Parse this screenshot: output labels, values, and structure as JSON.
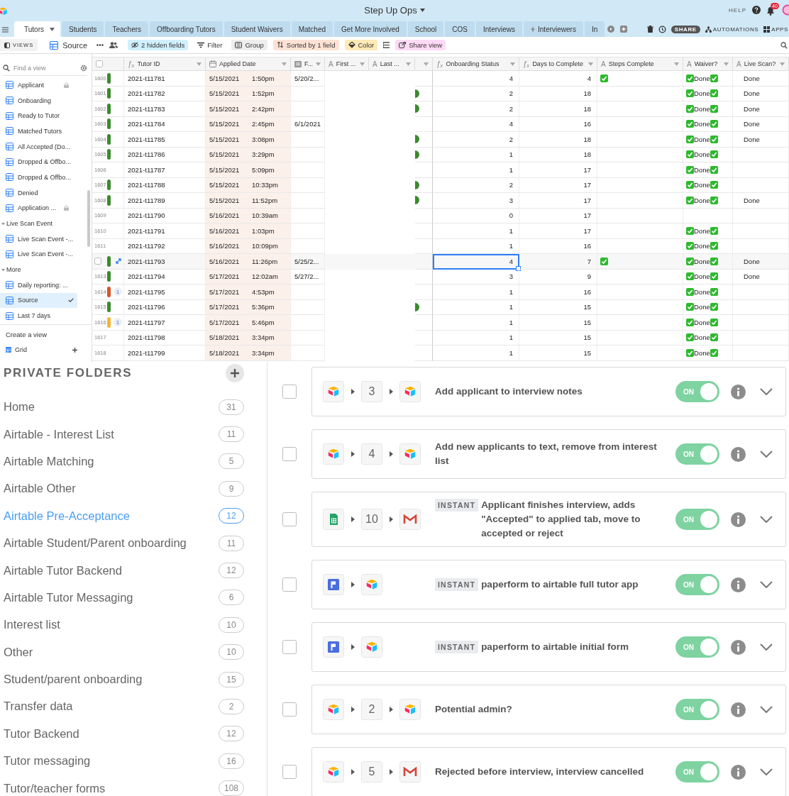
{
  "header": {
    "title": "Step Up Ops",
    "help": "HELP",
    "notifications": "40"
  },
  "tabs": [
    {
      "label": "Tutors",
      "kind": "plain",
      "selected": true
    },
    {
      "label": "Students",
      "kind": "plain",
      "selected": false
    },
    {
      "label": "Teachers",
      "kind": "plain",
      "selected": false
    },
    {
      "label": "Offboarding Tutors",
      "kind": "plain",
      "selected": false
    },
    {
      "label": "Student Waivers",
      "kind": "plain",
      "selected": false
    },
    {
      "label": "Matched",
      "kind": "plain",
      "selected": false
    },
    {
      "label": "Get More Involved",
      "kind": "plain",
      "selected": false
    },
    {
      "label": "School",
      "kind": "plain",
      "selected": false
    },
    {
      "label": "COS",
      "kind": "plain",
      "selected": false
    },
    {
      "label": "Interviews",
      "kind": "plain",
      "selected": false
    },
    {
      "label": "Interviewers",
      "kind": "synced",
      "selected": false
    },
    {
      "label": "In",
      "kind": "plain",
      "selected": false
    }
  ],
  "tab_actions": {
    "share": "SHARE",
    "automations": "AUTOMATIONS",
    "apps": "APPS"
  },
  "toolbar": {
    "views": "VIEWS",
    "view_name": "Source",
    "buttons": [
      {
        "label": "2 hidden fields",
        "kind": "hide",
        "color": "#d0f0fd"
      },
      {
        "label": "Filter",
        "kind": "filter"
      },
      {
        "label": "Group",
        "kind": "group",
        "color": "#eeeeee"
      },
      {
        "label": "Sorted by 1 field",
        "kind": "sort",
        "color": "#fee2d5"
      },
      {
        "label": "Color",
        "kind": "color",
        "color": "#ffeab6"
      }
    ],
    "share": {
      "label": "Share view",
      "color": "#ffdaf6"
    }
  },
  "sidebar": {
    "search": {
      "placeholder": "Find a view"
    },
    "views": [
      {
        "label": "Applicant",
        "kind": "view",
        "locked": true,
        "selected": false
      },
      {
        "label": "Onboarding",
        "kind": "view",
        "locked": false,
        "selected": false
      },
      {
        "label": "Ready to Tutor",
        "kind": "view",
        "locked": false,
        "selected": false
      },
      {
        "label": "Matched Tutors",
        "kind": "view",
        "locked": false,
        "selected": false
      },
      {
        "label": "All Accepted (Do...",
        "kind": "view",
        "locked": false,
        "selected": false
      },
      {
        "label": "Dropped & Offbo...",
        "kind": "view",
        "locked": false,
        "selected": false
      },
      {
        "label": "Dropped & Offbo...",
        "kind": "view",
        "locked": false,
        "selected": false
      },
      {
        "label": "Denied",
        "kind": "view",
        "locked": false,
        "selected": false
      },
      {
        "label": "Application ...",
        "kind": "view",
        "locked": true,
        "selected": false
      },
      {
        "label": "Live Scan Event",
        "kind": "section",
        "expanded": true,
        "children": [
          {
            "label": "Live Scan Event -...",
            "kind": "view",
            "locked": false,
            "selected": false
          },
          {
            "label": "Live Scan Event -...",
            "kind": "view",
            "locked": false,
            "selected": false
          }
        ]
      },
      {
        "label": "More",
        "kind": "section",
        "expanded": true,
        "children": [
          {
            "label": "Daily reporting: ...",
            "kind": "view",
            "locked": false,
            "selected": false
          },
          {
            "label": "Source",
            "kind": "view",
            "locked": false,
            "selected": true
          },
          {
            "label": "Last 7 days",
            "kind": "view",
            "locked": false,
            "selected": false
          }
        ]
      }
    ],
    "create": {
      "title": "Create a view",
      "options": [
        {
          "label": "Grid"
        }
      ]
    }
  },
  "grid": {
    "all_checked": false,
    "columns": [
      {
        "label": "Tutor ID",
        "kind": "formula",
        "icon": "ƒₓ"
      },
      {
        "label": "Applied Date",
        "kind": "date"
      },
      {
        "label": "F...",
        "kind": "calendar"
      },
      {
        "label": "First ...",
        "kind": "text",
        "icon": "A"
      },
      {
        "label": "Last ...",
        "kind": "text",
        "icon": "A"
      },
      {
        "kind": "none"
      },
      {
        "label": "Onboarding Status",
        "kind": "formula",
        "icon": "ƒₓ"
      },
      {
        "label": "Days to Complete",
        "kind": "formula",
        "icon": "ƒₓ"
      },
      {
        "label": "Steps Complete",
        "kind": "text",
        "icon": "A"
      },
      {
        "label": "Waiver?",
        "kind": "text",
        "icon": "A"
      },
      {
        "label": "Live Scan?",
        "kind": "text",
        "icon": "A"
      }
    ],
    "rows": [
      {
        "number": "1600",
        "color": "#3b8a2c",
        "tutor_id": "2021-t11781",
        "date": "5/15/2021",
        "time": "1:50pm",
        "f": "5/20/2...",
        "dot": false,
        "onboarding": "4",
        "days": "4",
        "steps_complete": true,
        "waiver": "Done",
        "live_scan": "Done",
        "hovered": false,
        "selected": false
      },
      {
        "number": "1601",
        "color": "#3b8a2c",
        "tutor_id": "2021-t11782",
        "date": "5/15/2021",
        "time": "1:52pm",
        "dot": true,
        "onboarding": "2",
        "days": "18",
        "steps_complete": false,
        "waiver": "Done",
        "live_scan": "Done",
        "hovered": false,
        "selected": false
      },
      {
        "number": "1602",
        "color": "#3b8a2c",
        "tutor_id": "2021-t11783",
        "date": "5/15/2021",
        "time": "2:42pm",
        "dot": true,
        "onboarding": "2",
        "days": "18",
        "steps_complete": false,
        "waiver": "Done",
        "live_scan": "Done",
        "hovered": false,
        "selected": false
      },
      {
        "number": "1603",
        "color": "#3b8a2c",
        "tutor_id": "2021-t11784",
        "date": "5/15/2021",
        "time": "2:45pm",
        "f": "6/1/2021",
        "dot": false,
        "onboarding": "4",
        "days": "16",
        "steps_complete": false,
        "waiver": "Done",
        "live_scan": "Done",
        "hovered": false,
        "selected": false
      },
      {
        "number": "1604",
        "color": "#3b8a2c",
        "tutor_id": "2021-t11785",
        "date": "5/15/2021",
        "time": "3:08pm",
        "dot": true,
        "onboarding": "2",
        "days": "18",
        "steps_complete": false,
        "waiver": "Done",
        "live_scan": "Done",
        "hovered": false,
        "selected": false
      },
      {
        "number": "1605",
        "color": "#3b8a2c",
        "tutor_id": "2021-t11786",
        "date": "5/15/2021",
        "time": "3:29pm",
        "dot": true,
        "onboarding": "1",
        "days": "18",
        "steps_complete": false,
        "waiver": "Done",
        "hovered": false,
        "selected": false
      },
      {
        "number": "1606",
        "tutor_id": "2021-t11787",
        "date": "5/15/2021",
        "time": "5:09pm",
        "dot": false,
        "onboarding": "1",
        "days": "17",
        "steps_complete": false,
        "waiver": "Done",
        "hovered": false,
        "selected": false
      },
      {
        "number": "1607",
        "color": "#3b8a2c",
        "tutor_id": "2021-t11788",
        "date": "5/15/2021",
        "time": "10:33pm",
        "dot": true,
        "onboarding": "2",
        "days": "17",
        "steps_complete": false,
        "waiver": "Done",
        "hovered": false,
        "selected": false
      },
      {
        "number": "1608",
        "color": "#3b8a2c",
        "tutor_id": "2021-t11789",
        "date": "5/15/2021",
        "time": "11:52pm",
        "dot": true,
        "onboarding": "3",
        "days": "17",
        "steps_complete": false,
        "waiver": "Done",
        "live_scan": "Done",
        "hovered": false,
        "selected": false
      },
      {
        "number": "1609",
        "tutor_id": "2021-t11790",
        "date": "5/16/2021",
        "time": "10:39am",
        "dot": false,
        "onboarding": "0",
        "days": "17",
        "steps_complete": false,
        "hovered": false,
        "selected": false
      },
      {
        "number": "1610",
        "tutor_id": "2021-t11791",
        "date": "5/16/2021",
        "time": "1:03pm",
        "dot": false,
        "onboarding": "1",
        "days": "17",
        "steps_complete": false,
        "waiver": "Done",
        "hovered": false,
        "selected": false
      },
      {
        "number": "1611",
        "tutor_id": "2021-t11792",
        "date": "5/16/2021",
        "time": "10:09pm",
        "dot": false,
        "onboarding": "1",
        "days": "16",
        "steps_complete": false,
        "waiver": "Done",
        "hovered": false,
        "selected": false
      },
      {
        "color": "#3b8a2c",
        "tutor_id": "2021-t11793",
        "date": "5/16/2021",
        "time": "11:26pm",
        "f": "5/25/2...",
        "dot": false,
        "onboarding": "4",
        "days": "7",
        "steps_complete": true,
        "waiver": "Done",
        "live_scan": "Done",
        "hovered": true,
        "selected": true
      },
      {
        "number": "1613",
        "color": "#3b8a2c",
        "tutor_id": "2021-t11794",
        "date": "5/17/2021",
        "time": "12:02am",
        "f": "5/27/2...",
        "dot": false,
        "onboarding": "3",
        "days": "9",
        "steps_complete": false,
        "waiver": "Done",
        "live_scan": "Done",
        "hovered": false,
        "selected": false
      },
      {
        "number": "1614",
        "color": "#d4562b",
        "comments": "1",
        "tutor_id": "2021-t11795",
        "date": "5/17/2021",
        "time": "4:53pm",
        "dot": false,
        "onboarding": "1",
        "days": "16",
        "steps_complete": false,
        "waiver": "Done",
        "hovered": false,
        "selected": false
      },
      {
        "number": "1615",
        "color": "#3b8a2c",
        "tutor_id": "2021-t11796",
        "date": "5/17/2021",
        "time": "5:36pm",
        "dot": true,
        "onboarding": "1",
        "days": "15",
        "steps_complete": false,
        "waiver": "Done",
        "hovered": false,
        "selected": false
      },
      {
        "number": "1616",
        "color": "#f5b53a",
        "comments": "1",
        "tutor_id": "2021-t11797",
        "date": "5/17/2021",
        "time": "5:46pm",
        "dot": false,
        "onboarding": "1",
        "days": "15",
        "steps_complete": false,
        "waiver": "Done",
        "hovered": false,
        "selected": false
      },
      {
        "number": "1617",
        "tutor_id": "2021-t11798",
        "date": "5/18/2021",
        "time": "3:34pm",
        "dot": false,
        "onboarding": "1",
        "days": "15",
        "steps_complete": false,
        "waiver": "Done",
        "hovered": false,
        "selected": false
      },
      {
        "number": "1618",
        "tutor_id": "2021-t11799",
        "date": "5/18/2021",
        "time": "3:34pm",
        "dot": false,
        "onboarding": "1",
        "days": "15",
        "steps_complete": false,
        "waiver": "Done",
        "hovered": false,
        "selected": false
      }
    ]
  },
  "folders": {
    "title": "PRIVATE FOLDERS",
    "items": [
      {
        "name": "Home",
        "count": "31",
        "selected": false
      },
      {
        "name": "Airtable - Interest List",
        "count": "11",
        "selected": false
      },
      {
        "name": "Airtable Matching",
        "count": "5",
        "selected": false
      },
      {
        "name": "Airtable Other",
        "count": "9",
        "selected": false
      },
      {
        "name": "Airtable Pre-Acceptance",
        "count": "12",
        "selected": true
      },
      {
        "name": "Airtable Student/Parent onboarding",
        "count": "11",
        "selected": false
      },
      {
        "name": "Airtable Tutor Backend",
        "count": "12",
        "selected": false
      },
      {
        "name": "Airtable Tutor Messaging",
        "count": "6",
        "selected": false
      },
      {
        "name": "Interest list",
        "count": "10",
        "selected": false
      },
      {
        "name": "Other",
        "count": "10",
        "selected": false
      },
      {
        "name": "Student/parent onboarding",
        "count": "15",
        "selected": false
      },
      {
        "name": "Transfer data",
        "count": "2",
        "selected": false
      },
      {
        "name": "Tutor Backend",
        "count": "12",
        "selected": false
      },
      {
        "name": "Tutor messaging",
        "count": "16",
        "selected": false
      },
      {
        "name": "Tutor/teacher forms",
        "count": "108",
        "selected": false
      }
    ]
  },
  "zaps": [
    {
      "checked": false,
      "trigger": {
        "kind": "cube"
      },
      "steps": "3",
      "action": {
        "kind": "cube"
      },
      "instant": false,
      "title": "Add applicant to interview notes",
      "toggle": "ON",
      "on": true
    },
    {
      "checked": false,
      "trigger": {
        "kind": "cube"
      },
      "steps": "4",
      "action": {
        "kind": "cube"
      },
      "instant": false,
      "title": "Add new applicants to text, remove from interest list",
      "toggle": "ON",
      "on": true
    },
    {
      "checked": false,
      "trigger": {
        "kind": "sheet"
      },
      "steps": "10",
      "action": {
        "kind": "mail"
      },
      "instant": true,
      "badge": "INSTANT",
      "title": "Applicant finishes interview, adds \"Accepted\" to applied tab, move to accepted or reject",
      "toggle": "ON",
      "on": true
    },
    {
      "checked": false,
      "trigger": {
        "kind": "flag"
      },
      "action": {
        "kind": "cube"
      },
      "instant": true,
      "badge": "INSTANT",
      "title": "paperform to airtable full tutor app",
      "toggle": "ON",
      "on": true
    },
    {
      "checked": false,
      "trigger": {
        "kind": "flag"
      },
      "action": {
        "kind": "cube"
      },
      "instant": true,
      "badge": "INSTANT",
      "title": "paperform to airtable initial form",
      "toggle": "ON",
      "on": true
    },
    {
      "checked": false,
      "trigger": {
        "kind": "cube"
      },
      "steps": "2",
      "action": {
        "kind": "cube"
      },
      "instant": false,
      "title": "Potential admin?",
      "toggle": "ON",
      "on": true
    },
    {
      "checked": false,
      "trigger": {
        "kind": "cube"
      },
      "steps": "5",
      "action": {
        "kind": "mail"
      },
      "instant": false,
      "title": "Rejected before interview, interview cancelled",
      "toggle": "ON",
      "on": true
    }
  ]
}
